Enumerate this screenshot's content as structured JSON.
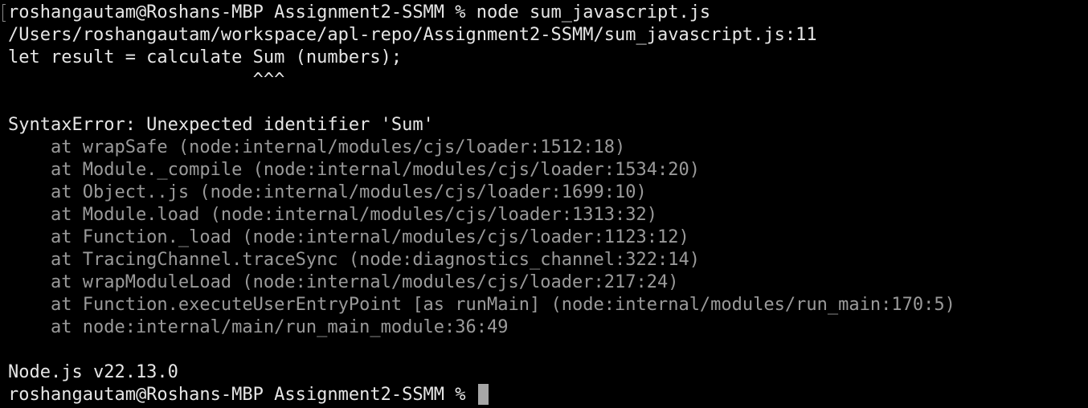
{
  "terminal": {
    "lines": [
      "roshangautam@Roshans-MBP Assignment2-SSMM % node sum_javascript.js",
      "/Users/roshangautam/workspace/apl-repo/Assignment2-SSMM/sum_javascript.js:11",
      "let result = calculate Sum (numbers);",
      "                       ^^^",
      "",
      "SyntaxError: Unexpected identifier 'Sum'",
      "    at wrapSafe (node:internal/modules/cjs/loader:1512:18)",
      "    at Module._compile (node:internal/modules/cjs/loader:1534:20)",
      "    at Object..js (node:internal/modules/cjs/loader:1699:10)",
      "    at Module.load (node:internal/modules/cjs/loader:1313:32)",
      "    at Function._load (node:internal/modules/cjs/loader:1123:12)",
      "    at TracingChannel.traceSync (node:diagnostics_channel:322:14)",
      "    at wrapModuleLoad (node:internal/modules/cjs/loader:217:24)",
      "    at Function.executeUserEntryPoint [as runMain] (node:internal/modules/run_main:170:5)",
      "    at node:internal/main/run_main_module:36:49",
      "",
      "Node.js v22.13.0"
    ],
    "prompt": "roshangautam@Roshans-MBP Assignment2-SSMM % "
  },
  "colors": {
    "background": "#000000",
    "text": "#e6e6e6",
    "stack_trace": "#9a9a9a",
    "cursor": "#a6a6a6"
  }
}
